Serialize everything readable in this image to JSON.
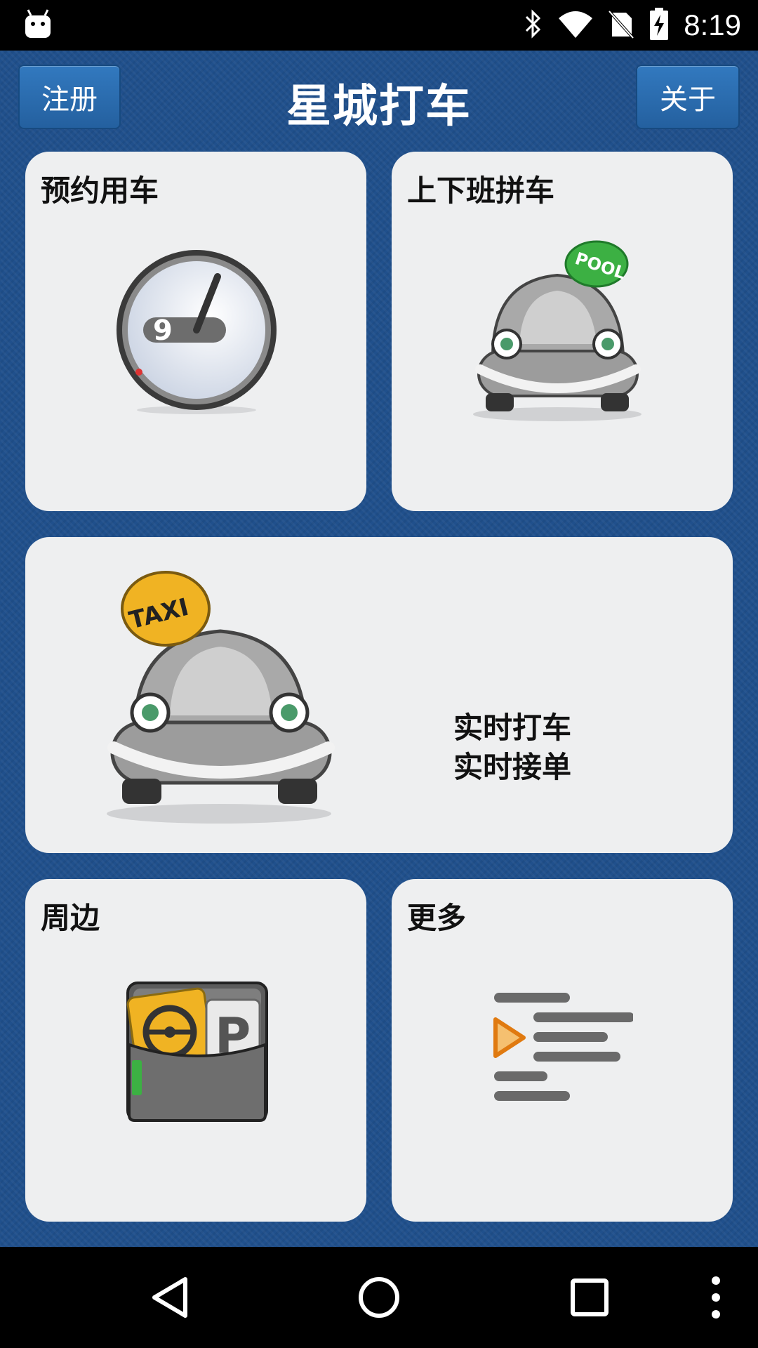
{
  "status_bar": {
    "time": "8:19",
    "icons": [
      "android-icon",
      "bluetooth-icon",
      "wifi-icon",
      "no-sim-icon",
      "battery-charging-icon"
    ]
  },
  "header": {
    "title": "星城打车",
    "register_label": "注册",
    "about_label": "关于"
  },
  "cards": {
    "reserve": {
      "label": "预约用车",
      "icon": "clock-icon"
    },
    "carpool": {
      "label": "上下班拼车",
      "icon": "pool-car-icon",
      "badge": "POOL"
    },
    "realtime": {
      "line1": "实时打车",
      "line2": "实时接单",
      "icon": "taxi-car-icon",
      "badge": "TAXI"
    },
    "nearby": {
      "label": "周边",
      "icon": "wallet-icon"
    },
    "more": {
      "label": "更多",
      "icon": "menu-list-icon"
    }
  },
  "nav_bar": {
    "icons": [
      "back-icon",
      "home-icon",
      "recents-icon",
      "overflow-menu-icon"
    ]
  },
  "colors": {
    "app_background": "#20508c",
    "button": "#2a6aad",
    "card": "#eeeff0"
  }
}
